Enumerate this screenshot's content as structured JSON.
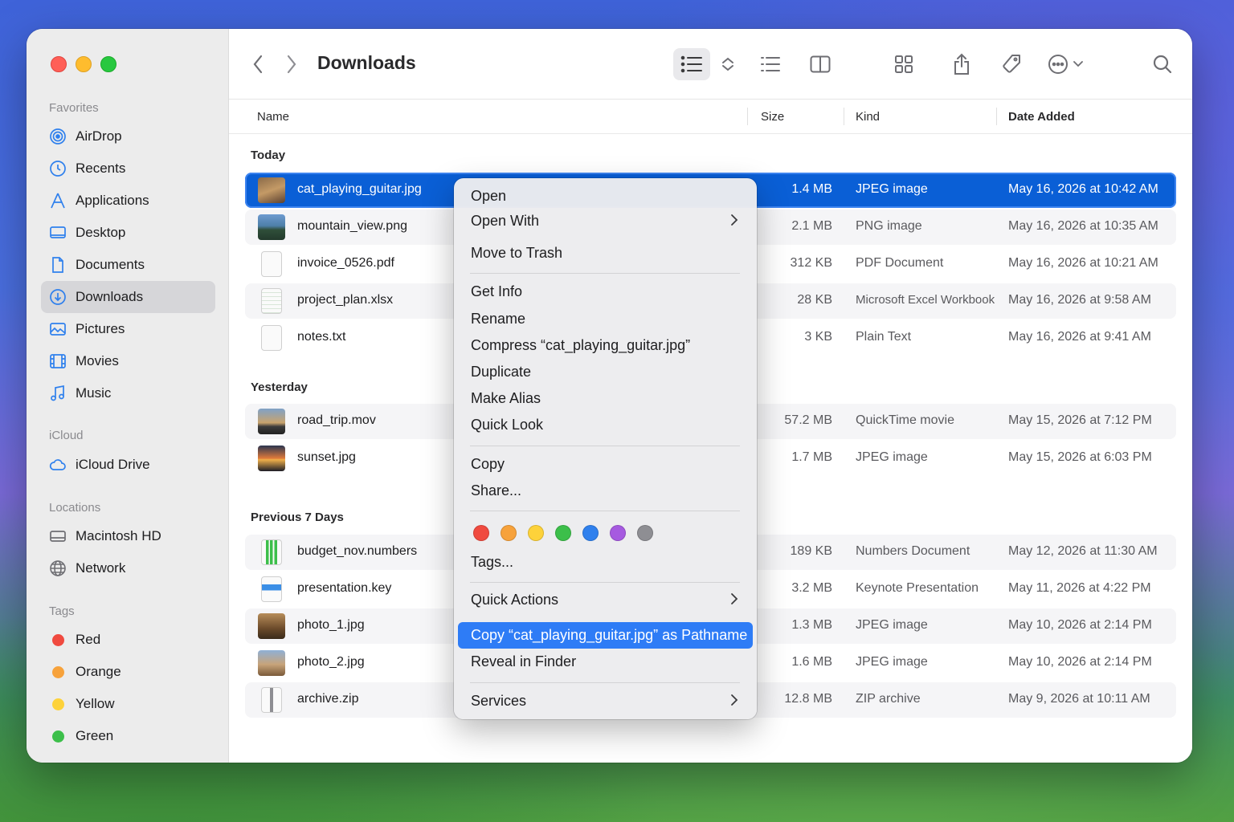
{
  "window": {
    "title": "Downloads"
  },
  "sidebar": {
    "favorites_title": "Favorites",
    "favorites": [
      {
        "label": "AirDrop",
        "icon": "airdrop-icon"
      },
      {
        "label": "Recents",
        "icon": "clock-icon"
      },
      {
        "label": "Applications",
        "icon": "applications-icon"
      },
      {
        "label": "Desktop",
        "icon": "desktop-icon"
      },
      {
        "label": "Documents",
        "icon": "document-icon"
      },
      {
        "label": "Downloads",
        "icon": "download-icon",
        "active": true
      },
      {
        "label": "Pictures",
        "icon": "pictures-icon"
      },
      {
        "label": "Movies",
        "icon": "film-icon"
      },
      {
        "label": "Music",
        "icon": "music-note-icon"
      }
    ],
    "icloud_title": "iCloud",
    "icloud": [
      {
        "label": "iCloud Drive",
        "icon": "cloud-icon"
      }
    ],
    "locations_title": "Locations",
    "locations": [
      {
        "label": "Macintosh HD",
        "icon": "hard-drive-icon"
      },
      {
        "label": "Network",
        "icon": "globe-icon"
      }
    ],
    "tags_title": "Tags",
    "tags": [
      {
        "label": "Red",
        "color": "#f04a3f"
      },
      {
        "label": "Orange",
        "color": "#f7a23b"
      },
      {
        "label": "Yellow",
        "color": "#fdd23a"
      },
      {
        "label": "Green",
        "color": "#3cbf4a"
      }
    ]
  },
  "columns": {
    "name": "Name",
    "size": "Size",
    "kind": "Kind",
    "date_added": "Date Added"
  },
  "groups": [
    {
      "title": "Today"
    },
    {
      "title": "Yesterday"
    },
    {
      "title": "Previous 7 Days"
    }
  ],
  "files": [
    {
      "name": "cat_playing_guitar.jpg",
      "size": "1.4 MB",
      "kind": "JPEG image",
      "date": "May 16, 2026 at 10:42 AM"
    },
    {
      "name": "mountain_view.png",
      "size": "2.1 MB",
      "kind": "PNG image",
      "date": "May 16, 2026 at 10:35 AM"
    },
    {
      "name": "invoice_0526.pdf",
      "size": "312 KB",
      "kind": "PDF Document",
      "date": "May 16, 2026 at 10:21 AM"
    },
    {
      "name": "project_plan.xlsx",
      "size": "28 KB",
      "kind": "Microsoft Excel Workbook",
      "date": "May 16, 2026 at 9:58 AM"
    },
    {
      "name": "notes.txt",
      "size": "3 KB",
      "kind": "Plain Text",
      "date": "May 16, 2026 at 9:41 AM"
    },
    {
      "name": "road_trip.mov",
      "size": "57.2 MB",
      "kind": "QuickTime movie",
      "date": "May 15, 2026 at 7:12 PM"
    },
    {
      "name": "sunset.jpg",
      "size": "1.7 MB",
      "kind": "JPEG image",
      "date": "May 15, 2026 at 6:03 PM"
    },
    {
      "name": "budget_nov.numbers",
      "size": "189 KB",
      "kind": "Numbers Document",
      "date": "May 12, 2026 at 11:30 AM"
    },
    {
      "name": "presentation.key",
      "size": "3.2 MB",
      "kind": "Keynote Presentation",
      "date": "May 11, 2026 at 4:22 PM"
    },
    {
      "name": "photo_1.jpg",
      "size": "1.3 MB",
      "kind": "JPEG image",
      "date": "May 10, 2026 at 2:14 PM"
    },
    {
      "name": "photo_2.jpg",
      "size": "1.6 MB",
      "kind": "JPEG image",
      "date": "May 10, 2026 at 2:14 PM"
    },
    {
      "name": "archive.zip",
      "size": "12.8 MB",
      "kind": "ZIP archive",
      "date": "May 9, 2026 at 10:11 AM"
    }
  ],
  "context_menu": {
    "open": "Open",
    "open_with": "Open With",
    "move_to_trash": "Move to Trash",
    "get_info": "Get Info",
    "rename": "Rename",
    "compress": "Compress “cat_playing_guitar.jpg”",
    "duplicate": "Duplicate",
    "make_alias": "Make Alias",
    "quick_look": "Quick Look",
    "copy": "Copy",
    "share": "Share...",
    "tag_colors": [
      "#f04a3f",
      "#f7a23b",
      "#fdd23a",
      "#3cbf4a",
      "#2f80ed",
      "#a65ae0",
      "#8e8e93"
    ],
    "tags": "Tags...",
    "quick_actions": "Quick Actions",
    "copy_pathname": "Copy “cat_playing_guitar.jpg” as Pathname",
    "reveal_in_finder": "Reveal in Finder",
    "services": "Services"
  }
}
